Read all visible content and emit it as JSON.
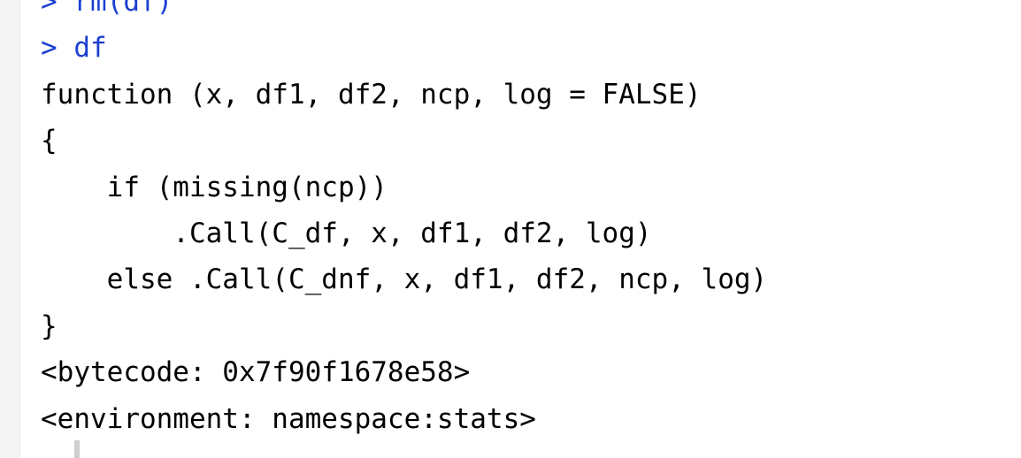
{
  "console": {
    "prompt_symbol": ">",
    "lines": [
      {
        "kind": "input",
        "text": "rm(df)"
      },
      {
        "kind": "input",
        "text": "df"
      },
      {
        "kind": "output",
        "text": "function (x, df1, df2, ncp, log = FALSE)"
      },
      {
        "kind": "output",
        "text": "{"
      },
      {
        "kind": "output",
        "text": "    if (missing(ncp))"
      },
      {
        "kind": "output",
        "text": "        .Call(C_df, x, df1, df2, log)"
      },
      {
        "kind": "output",
        "text": "    else .Call(C_dnf, x, df1, df2, ncp, log)"
      },
      {
        "kind": "output",
        "text": "}"
      },
      {
        "kind": "output",
        "text": "<bytecode: 0x7f90f1678e58>"
      },
      {
        "kind": "output",
        "text": "<environment: namespace:stats>"
      }
    ]
  }
}
